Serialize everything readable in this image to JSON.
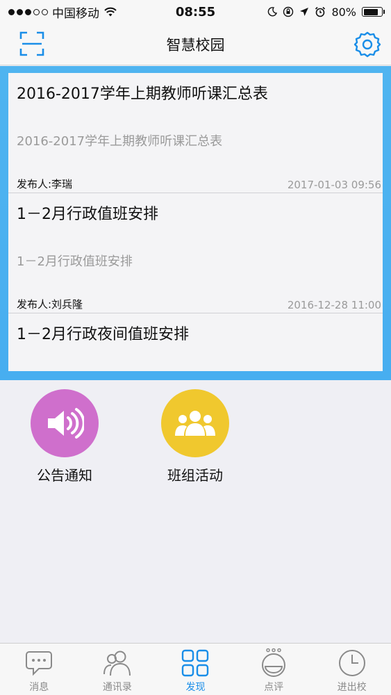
{
  "status_bar": {
    "carrier": "中国移动",
    "time": "08:55",
    "battery": "80%",
    "battery_level": 0.8
  },
  "nav": {
    "title": "智慧校园"
  },
  "notices": [
    {
      "title": "2016-2017学年上期教师听课汇总表",
      "summary": "2016-2017学年上期教师听课汇总表",
      "publisher": "发布人:李瑞",
      "time": "2017-01-03 09:56"
    },
    {
      "title": "1－2月行政值班安排",
      "summary": "1－2月行政值班安排",
      "publisher": "发布人:刘兵隆",
      "time": "2016-12-28  11:00"
    },
    {
      "title": "1－2月行政夜间值班安排"
    }
  ],
  "features": [
    {
      "label": "公告通知",
      "color": "#cf6fcc",
      "icon": "speaker-icon"
    },
    {
      "label": "班组活动",
      "color": "#f0c82e",
      "icon": "group-icon"
    }
  ],
  "tabs": [
    {
      "label": "消息",
      "icon": "chat-bubble-icon"
    },
    {
      "label": "通讯录",
      "icon": "contacts-icon"
    },
    {
      "label": "发现",
      "icon": "grid-icon",
      "active": true
    },
    {
      "label": "点评",
      "icon": "smiley-icon"
    },
    {
      "label": "进出校",
      "icon": "clock-icon"
    }
  ],
  "colors": {
    "accent": "#1a8ee8",
    "banner": "#4fb4f0"
  }
}
